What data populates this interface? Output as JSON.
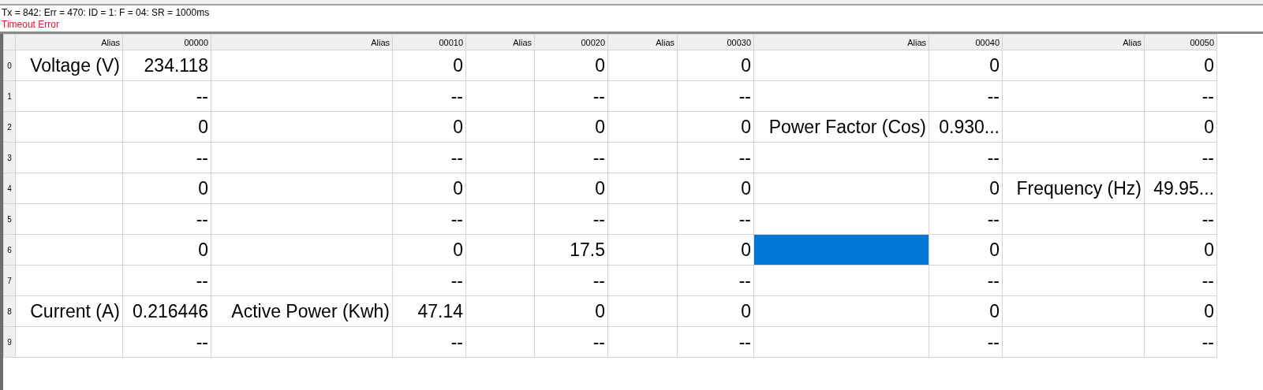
{
  "status": {
    "counters": "Tx = 842: Err = 470: ID = 1: F = 04: SR = 1000ms",
    "error": "Timeout Error"
  },
  "table": {
    "columns": [
      "Alias",
      "00000",
      "Alias",
      "00010",
      "Alias",
      "00020",
      "Alias",
      "00030",
      "Alias",
      "00040",
      "Alias",
      "00050"
    ],
    "rows": [
      {
        "number": "0",
        "cells": [
          {
            "text": "Voltage (V)",
            "selected": false
          },
          {
            "text": "234.118",
            "selected": false
          },
          {
            "selected": false
          },
          {
            "text": "0",
            "selected": false
          },
          {
            "selected": false
          },
          {
            "text": "0",
            "selected": false
          },
          {
            "selected": false
          },
          {
            "text": "0",
            "selected": false
          },
          {
            "selected": false
          },
          {
            "text": "0",
            "selected": false
          },
          {
            "selected": false
          },
          {
            "text": "0",
            "selected": false
          }
        ]
      },
      {
        "number": "1",
        "cells": [
          {
            "selected": false
          },
          {
            "text": "--",
            "selected": false
          },
          {
            "selected": false
          },
          {
            "text": "--",
            "selected": false
          },
          {
            "selected": false
          },
          {
            "text": "--",
            "selected": false
          },
          {
            "selected": false
          },
          {
            "text": "--",
            "selected": false
          },
          {
            "selected": false
          },
          {
            "text": "--",
            "selected": false
          },
          {
            "selected": false
          },
          {
            "text": "--",
            "selected": false
          }
        ]
      },
      {
        "number": "2",
        "cells": [
          {
            "selected": false
          },
          {
            "text": "0",
            "selected": false
          },
          {
            "selected": false
          },
          {
            "text": "0",
            "selected": false
          },
          {
            "selected": false
          },
          {
            "text": "0",
            "selected": false
          },
          {
            "selected": false
          },
          {
            "text": "0",
            "selected": false
          },
          {
            "text": "Power Factor (Cos)",
            "selected": false
          },
          {
            "text": "0.930...",
            "selected": false
          },
          {
            "selected": false
          },
          {
            "text": "0",
            "selected": false
          }
        ]
      },
      {
        "number": "3",
        "cells": [
          {
            "selected": false
          },
          {
            "text": "--",
            "selected": false
          },
          {
            "selected": false
          },
          {
            "text": "--",
            "selected": false
          },
          {
            "selected": false
          },
          {
            "text": "--",
            "selected": false
          },
          {
            "selected": false
          },
          {
            "text": "--",
            "selected": false
          },
          {
            "selected": false
          },
          {
            "text": "--",
            "selected": false
          },
          {
            "selected": false
          },
          {
            "text": "--",
            "selected": false
          }
        ]
      },
      {
        "number": "4",
        "cells": [
          {
            "selected": false
          },
          {
            "text": "0",
            "selected": false
          },
          {
            "selected": false
          },
          {
            "text": "0",
            "selected": false
          },
          {
            "selected": false
          },
          {
            "text": "0",
            "selected": false
          },
          {
            "selected": false
          },
          {
            "text": "0",
            "selected": false
          },
          {
            "selected": false
          },
          {
            "text": "0",
            "selected": false
          },
          {
            "text": "Frequency (Hz)",
            "selected": false
          },
          {
            "text": "49.95...",
            "selected": false
          }
        ]
      },
      {
        "number": "5",
        "cells": [
          {
            "selected": false
          },
          {
            "text": "--",
            "selected": false
          },
          {
            "selected": false
          },
          {
            "text": "--",
            "selected": false
          },
          {
            "selected": false
          },
          {
            "text": "--",
            "selected": false
          },
          {
            "selected": false
          },
          {
            "text": "--",
            "selected": false
          },
          {
            "selected": false
          },
          {
            "text": "--",
            "selected": false
          },
          {
            "selected": false
          },
          {
            "text": "--",
            "selected": false
          }
        ]
      },
      {
        "number": "6",
        "cells": [
          {
            "selected": false
          },
          {
            "text": "0",
            "selected": false
          },
          {
            "selected": false
          },
          {
            "text": "0",
            "selected": false
          },
          {
            "selected": false
          },
          {
            "text": "17.5",
            "selected": false
          },
          {
            "selected": false
          },
          {
            "text": "0",
            "selected": false
          },
          {
            "selected": true
          },
          {
            "text": "0",
            "selected": false
          },
          {
            "selected": false
          },
          {
            "text": "0",
            "selected": false
          }
        ]
      },
      {
        "number": "7",
        "cells": [
          {
            "selected": false
          },
          {
            "text": "--",
            "selected": false
          },
          {
            "selected": false
          },
          {
            "text": "--",
            "selected": false
          },
          {
            "selected": false
          },
          {
            "text": "--",
            "selected": false
          },
          {
            "selected": false
          },
          {
            "text": "--",
            "selected": false
          },
          {
            "selected": false
          },
          {
            "text": "--",
            "selected": false
          },
          {
            "selected": false
          },
          {
            "text": "--",
            "selected": false
          }
        ]
      },
      {
        "number": "8",
        "cells": [
          {
            "text": "Current (A)",
            "selected": false
          },
          {
            "text": "0.216446",
            "selected": false
          },
          {
            "text": "Active Power (Kwh)",
            "selected": false
          },
          {
            "text": "47.14",
            "selected": false
          },
          {
            "selected": false
          },
          {
            "text": "0",
            "selected": false
          },
          {
            "selected": false
          },
          {
            "text": "0",
            "selected": false
          },
          {
            "selected": false
          },
          {
            "text": "0",
            "selected": false
          },
          {
            "selected": false
          },
          {
            "text": "0",
            "selected": false
          }
        ]
      },
      {
        "number": "9",
        "cells": [
          {
            "selected": false
          },
          {
            "text": "--",
            "selected": false
          },
          {
            "selected": false
          },
          {
            "text": "--",
            "selected": false
          },
          {
            "selected": false
          },
          {
            "text": "--",
            "selected": false
          },
          {
            "selected": false
          },
          {
            "text": "--",
            "selected": false
          },
          {
            "selected": false
          },
          {
            "text": "--",
            "selected": false
          },
          {
            "selected": false
          },
          {
            "text": "--",
            "selected": false
          }
        ]
      }
    ]
  }
}
